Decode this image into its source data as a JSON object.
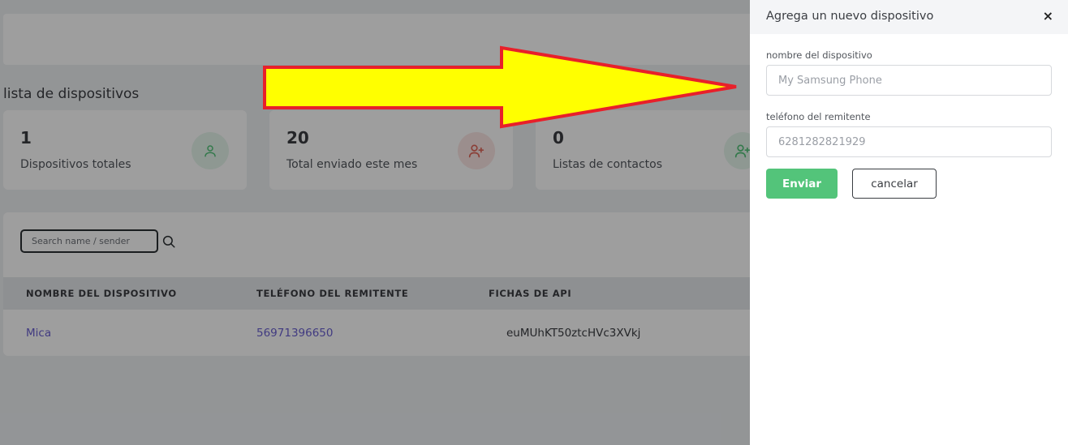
{
  "page": {
    "title": "lista de dispositivos"
  },
  "stats": [
    {
      "value": "1",
      "label": "Dispositivos totales",
      "icon": "user-icon",
      "color": "#53c47a"
    },
    {
      "value": "20",
      "label": "Total enviado este mes",
      "icon": "user-add-icon",
      "color": "#e0665a"
    },
    {
      "value": "0",
      "label": "Listas de contactos",
      "icon": "user-add-icon",
      "color": "#53c47a"
    }
  ],
  "table": {
    "search_placeholder": "Search name / sender",
    "columns": [
      "NOMBRE DEL DISPOSITIVO",
      "TELÉFONO DEL REMITENTE",
      "FICHAS DE API"
    ],
    "rows": [
      {
        "name": "Mica",
        "phone": "56971396650",
        "token": "euMUhKT50ztcHVc3XVkj"
      }
    ]
  },
  "panel": {
    "title": "Agrega un nuevo dispositivo",
    "close_label": "×",
    "device_name_label": "nombre del dispositivo",
    "device_name_placeholder": "My Samsung Phone",
    "sender_phone_label": "teléfono del remitente",
    "sender_phone_placeholder": "6281282821929",
    "submit_label": "Enviar",
    "cancel_label": "cancelar"
  },
  "colors": {
    "accent_green": "#53c47a",
    "accent_red": "#e0665a",
    "link_purple": "#6a5fd0",
    "arrow_fill": "#ffff00",
    "arrow_stroke": "#e8202a"
  }
}
